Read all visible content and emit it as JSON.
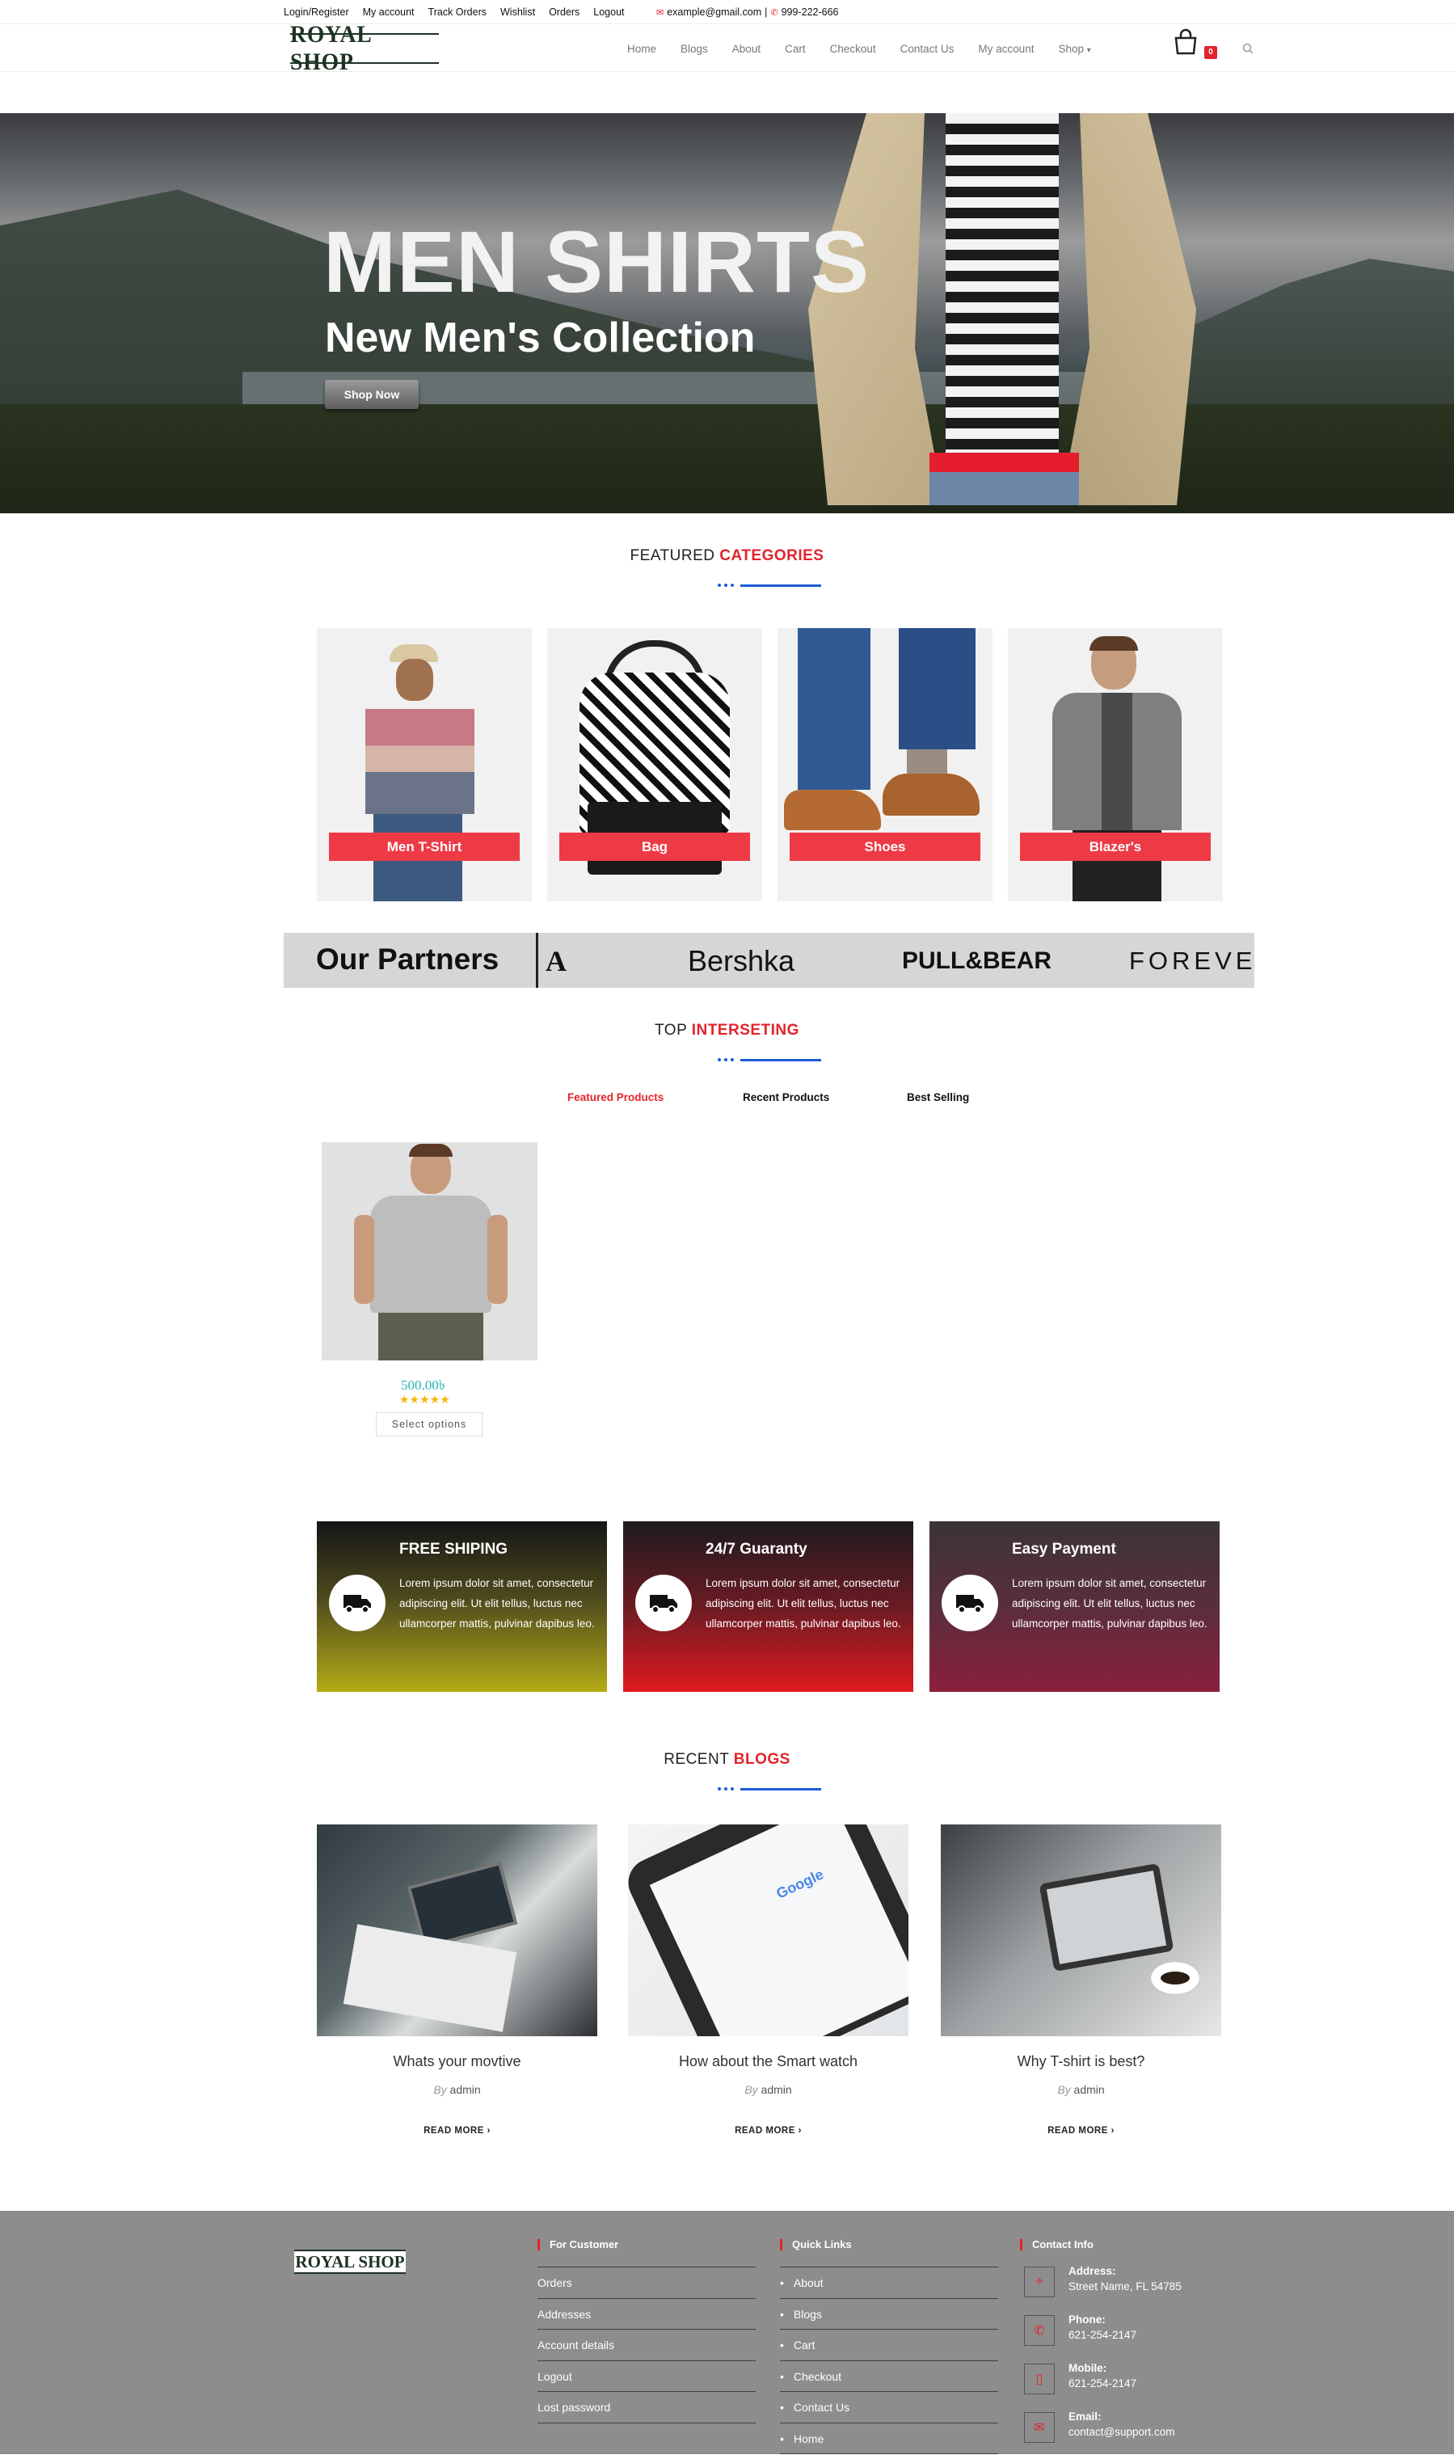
{
  "topbar": {
    "links": [
      "Login/Register",
      "My account",
      "Track Orders",
      "Wishlist",
      "Orders",
      "Logout"
    ],
    "email": "example@gmail.com",
    "separator": "|",
    "phone": "999-222-666"
  },
  "header": {
    "logo": "ROYAL SHOP",
    "nav": [
      "Home",
      "Blogs",
      "About",
      "Cart",
      "Checkout",
      "Contact Us",
      "My account",
      "Shop"
    ],
    "cart_count": "0"
  },
  "hero": {
    "title": "MEN SHIRTS",
    "subtitle": "New Men's Collection",
    "button": "Shop Now"
  },
  "featured": {
    "title_plain": "FEATURED",
    "title_red": "CATEGORIES",
    "categories": [
      "Men T-Shirt",
      "Bag",
      "Shoes",
      "Blazer's"
    ]
  },
  "partners": {
    "title": "Our Partners",
    "brands": [
      "A",
      "Bershka",
      "PULL&BEAR",
      "FOREVE"
    ]
  },
  "interesting": {
    "title_plain": "TOP",
    "title_red": "INTERSETING",
    "tabs": [
      "Featured Products",
      "Recent Products",
      "Best Selling"
    ],
    "active_tab": "Featured Products",
    "product": {
      "price": "500.00৳",
      "rating": 5,
      "stars": "★★★★★",
      "button": "Select options"
    }
  },
  "features": [
    {
      "title": "FREE SHIPING",
      "text": "Lorem ipsum dolor sit amet, consectetur adipiscing elit. Ut elit tellus, luctus nec ullamcorper mattis, pulvinar dapibus leo.",
      "icon": "truck-icon"
    },
    {
      "title": "24/7 Guaranty",
      "text": "Lorem ipsum dolor sit amet, consectetur adipiscing elit. Ut elit tellus, luctus nec ullamcorper mattis, pulvinar dapibus leo.",
      "icon": "truck-icon"
    },
    {
      "title": "Easy Payment",
      "text": "Lorem ipsum dolor sit amet, consectetur adipiscing elit. Ut elit tellus, luctus nec ullamcorper mattis, pulvinar dapibus leo.",
      "icon": "truck-icon"
    }
  ],
  "blogs": {
    "title_plain": "RECENT",
    "title_red": "BLOGS",
    "by_label": "By",
    "more_label": "READ MORE",
    "posts": [
      {
        "title": "Whats your movtive",
        "author": "admin"
      },
      {
        "title": "How about the Smart watch",
        "author": "admin"
      },
      {
        "title": "Why T-shirt is best?",
        "author": "admin"
      }
    ]
  },
  "footer": {
    "logo": "ROYAL SHOP",
    "customer": {
      "title": "For Customer",
      "links": [
        "Orders",
        "Addresses",
        "Account details",
        "Logout",
        "Lost password"
      ]
    },
    "quick": {
      "title": "Quick Links",
      "links": [
        "About",
        "Blogs",
        "Cart",
        "Checkout",
        "Contact Us",
        "Home"
      ]
    },
    "contact": {
      "title": "Contact Info",
      "items": [
        {
          "label": "Address:",
          "value": "Street Name, FL 54785"
        },
        {
          "label": "Phone:",
          "value": "621-254-2147"
        },
        {
          "label": "Mobile:",
          "value": "621-254-2147"
        },
        {
          "label": "Email:",
          "value": "contact@support.com"
        }
      ]
    }
  },
  "colors": {
    "accent": "#e3242b",
    "blue": "#1e5cd7",
    "teal_price": "#27b3b8"
  }
}
